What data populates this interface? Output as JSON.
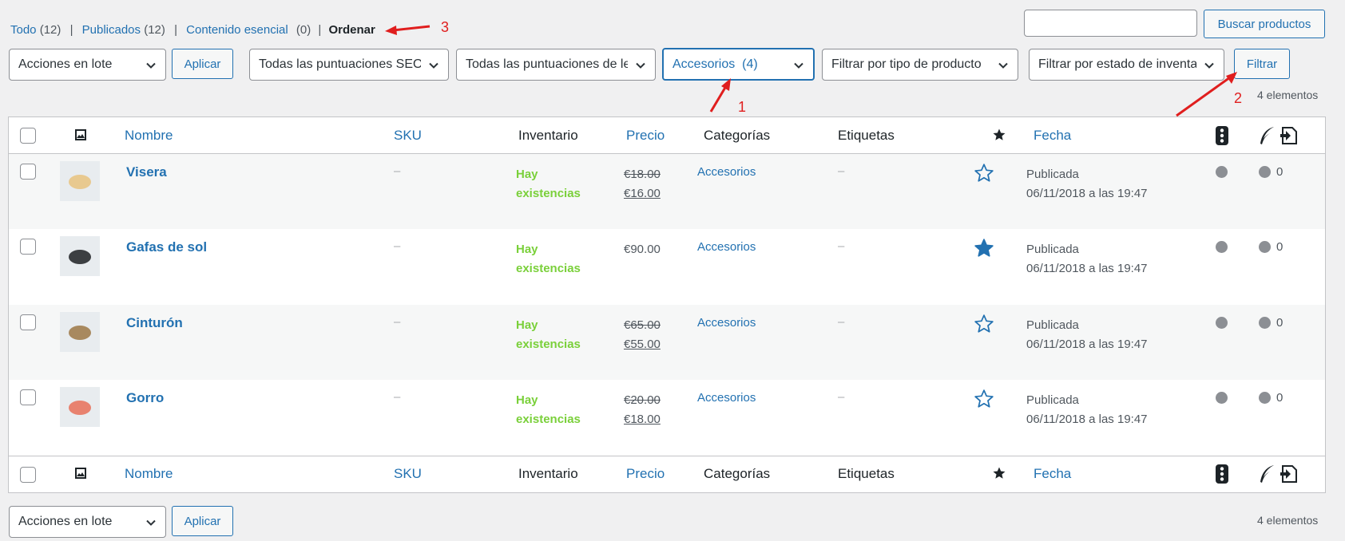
{
  "subsubsub": {
    "all_label": "Todo",
    "all_count": "(12)",
    "published_label": "Publicados",
    "published_count": "(12)",
    "essential_label": "Contenido esencial",
    "essential_count": "(0)",
    "sort_label": "Ordenar"
  },
  "search": {
    "value": "",
    "button": "Buscar productos"
  },
  "toolbar": {
    "bulk_actions": "Acciones en lote",
    "apply": "Aplicar",
    "seo_scores": "Todas las puntuaciones SEO",
    "readability_scores": "Todas las puntuaciones de legibilidad",
    "category": "Accesorios  (4)",
    "product_type": "Filtrar por tipo de producto",
    "stock_status": "Filtrar por estado de inventario",
    "filter": "Filtrar",
    "items_count": "4 elementos"
  },
  "columns": {
    "name": "Nombre",
    "sku": "SKU",
    "stock": "Inventario",
    "price": "Precio",
    "categories": "Categorías",
    "tags": "Etiquetas",
    "date": "Fecha"
  },
  "products": [
    {
      "name": "Visera",
      "sku": "–",
      "stock_line1": "Hay",
      "stock_line2": "existencias",
      "price_regular": "€18.00",
      "price_sale": "€16.00",
      "category": "Accesorios",
      "tags": "–",
      "featured": false,
      "status": "Publicada",
      "date": "06/11/2018 a las 19:47",
      "count": "0",
      "thumb_color": "#e8c98f"
    },
    {
      "name": "Gafas de sol",
      "sku": "–",
      "stock_line1": "Hay",
      "stock_line2": "existencias",
      "price_regular": "€90.00",
      "price_sale": "",
      "category": "Accesorios",
      "tags": "–",
      "featured": true,
      "status": "Publicada",
      "date": "06/11/2018 a las 19:47",
      "count": "0",
      "thumb_color": "#3c3f42"
    },
    {
      "name": "Cinturón",
      "sku": "–",
      "stock_line1": "Hay",
      "stock_line2": "existencias",
      "price_regular": "€65.00",
      "price_sale": "€55.00",
      "category": "Accesorios",
      "tags": "–",
      "featured": false,
      "status": "Publicada",
      "date": "06/11/2018 a las 19:47",
      "count": "0",
      "thumb_color": "#a8895f"
    },
    {
      "name": "Gorro",
      "sku": "–",
      "stock_line1": "Hay",
      "stock_line2": "existencias",
      "price_regular": "€20.00",
      "price_sale": "€18.00",
      "category": "Accesorios",
      "tags": "–",
      "featured": false,
      "status": "Publicada",
      "date": "06/11/2018 a las 19:47",
      "count": "0",
      "thumb_color": "#e8826f"
    }
  ],
  "annotations": {
    "one": "1",
    "two": "2",
    "three": "3"
  },
  "colors": {
    "accent": "#2271b1",
    "in_stock": "#7ad03a",
    "annotation": "#e01e1e"
  }
}
